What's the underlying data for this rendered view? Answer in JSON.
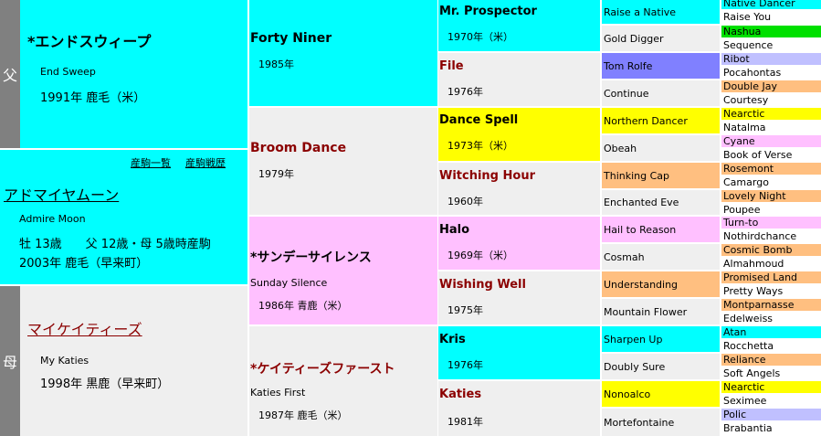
{
  "sidebar": {
    "sire_label": "父",
    "dam_label": "母"
  },
  "sire": {
    "name": "*エンドスウィープ",
    "en": "End Sweep",
    "info": "1991年  鹿毛（米）"
  },
  "horse": {
    "link_progeny": "産駒一覧",
    "link_record": "産駒戦歴",
    "name": "アドマイヤムーン",
    "en": "Admire Moon",
    "age_line": "牡  13歳　　父 12歳・母 5歳時産駒",
    "info": "2003年  鹿毛（早来町）"
  },
  "dam": {
    "name": "マイケイティーズ",
    "en": "My Katies",
    "info": "1998年  黒鹿（早来町）"
  },
  "gen1": [
    {
      "name": "Forty Niner",
      "en": "",
      "info": "1985年"
    },
    {
      "name": "Broom Dance",
      "en": "",
      "info": "1979年"
    },
    {
      "name": "*サンデーサイレンス",
      "en": "Sunday Silence",
      "info": "1986年  青鹿（米）"
    },
    {
      "name": "*ケイティーズファースト",
      "en": "Katies First",
      "info": "1987年  鹿毛（米）"
    }
  ],
  "gen2": [
    {
      "name": "Mr. Prospector",
      "info": "1970年（米）"
    },
    {
      "name": "File",
      "info": "1976年"
    },
    {
      "name": "Dance Spell",
      "info": "1973年（米）"
    },
    {
      "name": "Witching Hour",
      "info": "1960年"
    },
    {
      "name": "Halo",
      "info": "1969年（米）"
    },
    {
      "name": "Wishing Well",
      "info": "1975年"
    },
    {
      "name": "Kris",
      "info": "1976年"
    },
    {
      "name": "Katies",
      "info": "1981年"
    }
  ],
  "gen3": [
    "Raise a Native",
    "Gold Digger",
    "Tom Rolfe",
    "Continue",
    "Northern Dancer",
    "Obeah",
    "Thinking Cap",
    "Enchanted Eve",
    "Hail to Reason",
    "Cosmah",
    "Understanding",
    "Mountain Flower",
    "Sharpen Up",
    "Doubly Sure",
    "Nonoalco",
    "Mortefontaine"
  ],
  "gen4": [
    "Native Dancer",
    "Raise You",
    "Nashua",
    "Sequence",
    "Ribot",
    "Pocahontas",
    "Double Jay",
    "Courtesy",
    "Nearctic",
    "Natalma",
    "Cyane",
    "Book of Verse",
    "Rosemont",
    "Camargo",
    "Lovely Night",
    "Poupee",
    "Turn-to",
    "Nothirdchance",
    "Cosmic Bomb",
    "Almahmoud",
    "Promised Land",
    "Pretty Ways",
    "Montparnasse",
    "Edelweiss",
    "Atan",
    "Rocchetta",
    "Reliance",
    "Soft Angels",
    "Nearctic",
    "Seximee",
    "Polic",
    "Brabantia"
  ]
}
